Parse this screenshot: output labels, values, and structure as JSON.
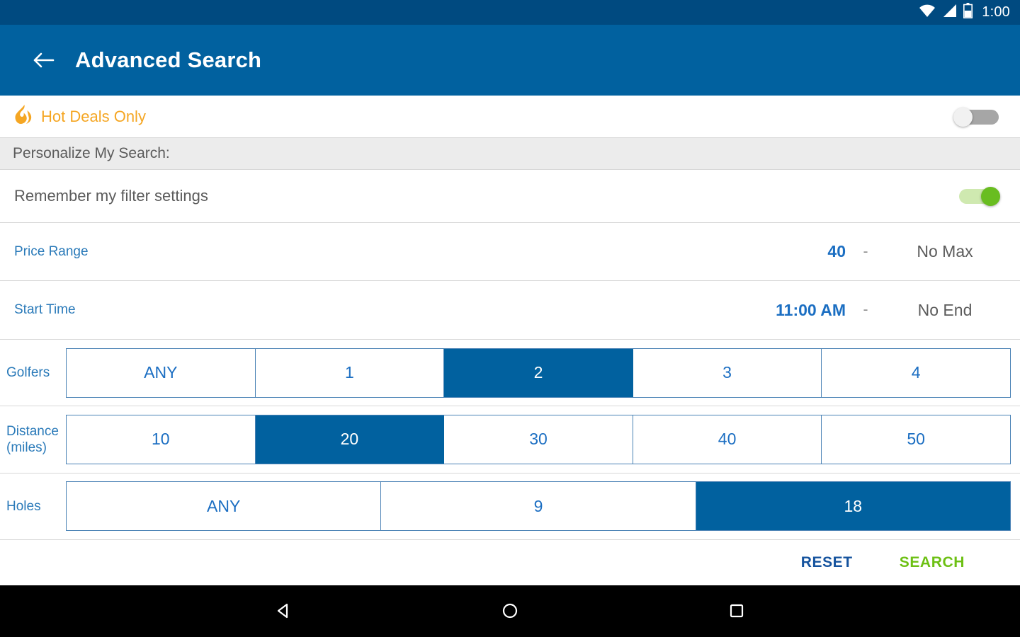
{
  "statusbar": {
    "time": "1:00",
    "icons": [
      "wifi-icon",
      "signal-icon",
      "battery-icon"
    ]
  },
  "appbar": {
    "back_icon": "back-arrow-icon",
    "title": "Advanced Search"
  },
  "hot_deals": {
    "icon": "flame-icon",
    "label": "Hot Deals Only",
    "toggle_state": "off"
  },
  "section": {
    "label": "Personalize My Search:"
  },
  "remember": {
    "label": "Remember my filter settings",
    "toggle_state": "on"
  },
  "price_range": {
    "label": "Price Range",
    "min": "40",
    "separator": "-",
    "max": "No Max"
  },
  "start_time": {
    "label": "Start Time",
    "start": "11:00 AM",
    "separator": "-",
    "end": "No End"
  },
  "golfers": {
    "label": "Golfers",
    "options": [
      "ANY",
      "1",
      "2",
      "3",
      "4"
    ],
    "selected": "2"
  },
  "distance": {
    "label": "Distance (miles)",
    "label_line1": "Distance",
    "label_line2": "(miles)",
    "options": [
      "10",
      "20",
      "30",
      "40",
      "50"
    ],
    "selected": "20"
  },
  "holes": {
    "label": "Holes",
    "options": [
      "ANY",
      "9",
      "18"
    ],
    "selected": "18"
  },
  "actions": {
    "reset_label": "RESET",
    "search_label": "SEARCH"
  },
  "navbar": {
    "back": "nav-back-icon",
    "home": "nav-home-icon",
    "recents": "nav-recents-icon"
  },
  "colors": {
    "status_bar": "#004a80",
    "app_bar": "#01619f",
    "accent_blue": "#01619f",
    "link_blue": "#2a7ab9",
    "orange": "#f5a623",
    "green_toggle": "#69bd20",
    "green_search": "#6dc014",
    "section_gray": "#ececec"
  }
}
